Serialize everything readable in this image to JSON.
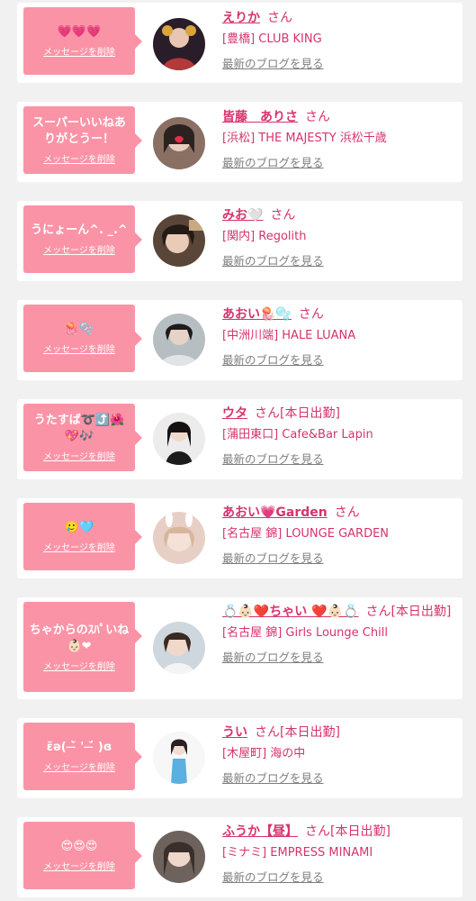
{
  "cards": [
    {
      "message": "💗💗💗",
      "delete_label": "メッセージを削除",
      "name": "えりか",
      "suffix": "さん",
      "shop": "[豊橋] CLUB KING",
      "blog_label": "最新のブログを見る",
      "avatar_color": "#3a2a3a"
    },
    {
      "message": "スーパーいいねありがとうー！",
      "delete_label": "メッセージを削除",
      "name": "皆藤　ありさ",
      "suffix": "さん",
      "shop": "[浜松] THE MAJESTY 浜松千歳",
      "blog_label": "最新のブログを見る",
      "avatar_color": "#8a6f63"
    },
    {
      "message": "うにょーん^. _.^",
      "delete_label": "メッセージを削除",
      "name": "みお🤍",
      "suffix": "さん",
      "shop": "[関内] Regolith",
      "blog_label": "最新のブログを見る",
      "avatar_color": "#5a4638"
    },
    {
      "message": "🪼🫧",
      "delete_label": "メッセージを削除",
      "name": "あおい🪼🫧",
      "suffix": "さん",
      "shop": "[中洲川端] HALE LUANA",
      "blog_label": "最新のブログを見る",
      "avatar_color": "#b7bec2"
    },
    {
      "message": "うたすば➰⤴️🌺💖🎶",
      "delete_label": "メッセージを削除",
      "name": "ウタ",
      "suffix": "さん[本日出勤]",
      "shop": "[蒲田東口] Cafe&Bar Lapin",
      "blog_label": "最新のブログを見る",
      "avatar_color": "#e9e9e9"
    },
    {
      "message": "🥲🩵",
      "delete_label": "メッセージを削除",
      "name": "あおい💗Garden",
      "suffix": "さん",
      "shop": "[名古屋 錦] LOUNGE GARDEN",
      "blog_label": "最新のブログを見る",
      "avatar_color": "#e8cfc6"
    },
    {
      "message": "ちゃからのｽﾊﾟいね👶🏻❤",
      "delete_label": "メッセージを削除",
      "name": "💍👶🏻❤️ちゃい ❤️👶🏻💍",
      "suffix": "さん[本日出勤]",
      "shop": "[名古屋 錦] Girls Lounge Chill",
      "blog_label": "最新のブログを見る",
      "avatar_color": "#cfd7de"
    },
    {
      "message": "ɛ̃ə( ˘̶̀ ' ˘̶́ )ɞ",
      "delete_label": "メッセージを削除",
      "name": "うい",
      "suffix": "さん[本日出勤]",
      "shop": "[木屋町] 海の中",
      "blog_label": "最新のブログを見る",
      "avatar_color": "#f3f3f3"
    },
    {
      "message": "😍😍😍",
      "delete_label": "メッセージを削除",
      "name": "ふうか【昼】",
      "suffix": "さん[本日出勤]",
      "shop": "[ミナミ] EMPRESS MINAMI",
      "blog_label": "最新のブログを見る",
      "avatar_color": "#6d625c"
    }
  ]
}
